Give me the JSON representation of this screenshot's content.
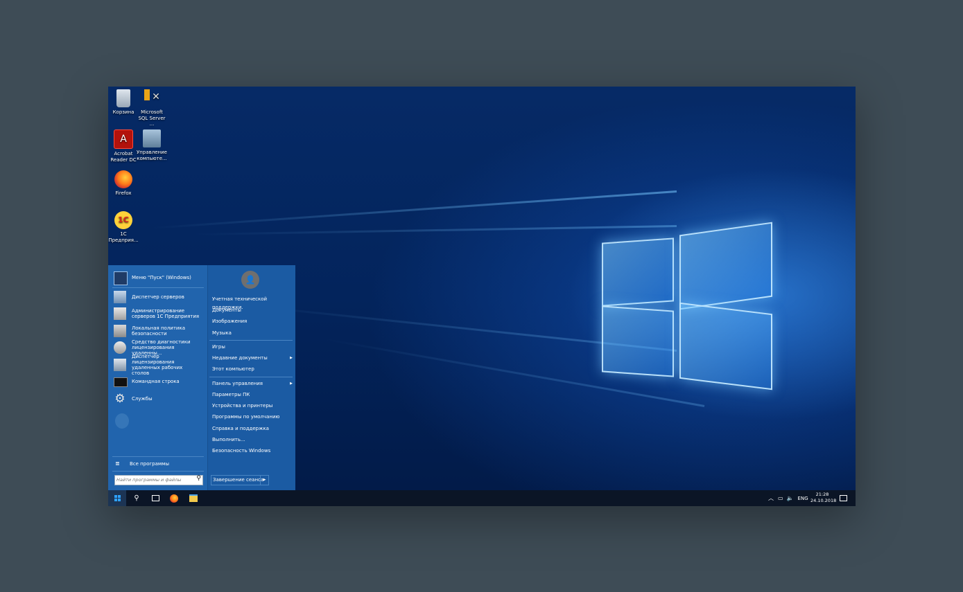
{
  "desktop": {
    "icons": [
      {
        "label": "Корзина"
      },
      {
        "label": "Microsoft SQL Server ..."
      },
      {
        "label": "Acrobat Reader DC"
      },
      {
        "label": "Управление компьюте..."
      },
      {
        "label": "Firefox"
      },
      {
        "label": "1C Предприя..."
      }
    ]
  },
  "start_menu": {
    "pinned": [
      {
        "label": "Меню \"Пуск\" (Windows)",
        "icon": "start-menu-icon"
      },
      {
        "label": "Диспетчер серверов",
        "icon": "server-manager-icon"
      },
      {
        "label": "Администрирование серверов 1С Предприятия",
        "icon": "1c-admin-icon"
      },
      {
        "label": "Локальная политика безопасности",
        "icon": "security-policy-icon"
      },
      {
        "label": "Средство диагностики лицензирования удаленны...",
        "icon": "license-diagnostics-icon"
      },
      {
        "label": "Диспетчер лицензирования удаленных рабочих столов",
        "icon": "rd-licensing-icon"
      },
      {
        "label": "Командная строка",
        "icon": "cmd-icon"
      },
      {
        "label": "Службы",
        "icon": "services-icon"
      }
    ],
    "all_programs": "Все программы",
    "search_placeholder": "Найти программы и файлы",
    "right_items": [
      {
        "label": "Учетная технической поддержки."
      },
      {
        "label": "Документы"
      },
      {
        "label": "Изображения"
      },
      {
        "label": "Музыка"
      },
      {
        "label": "Игры"
      },
      {
        "label": "Недавние документы"
      },
      {
        "label": "Этот компьютер"
      },
      {
        "label": "Панель управления"
      },
      {
        "label": "Параметры ПК"
      },
      {
        "label": "Устройства и принтеры"
      },
      {
        "label": "Программы по умолчанию"
      },
      {
        "label": "Справка и поддержка"
      },
      {
        "label": "Выполнить..."
      },
      {
        "label": "Безопасность Windows"
      }
    ],
    "shutdown_label": "Завершение сеанса"
  },
  "taskbar": {
    "language": "ENG",
    "time": "21:28",
    "date": "24.10.2018"
  }
}
